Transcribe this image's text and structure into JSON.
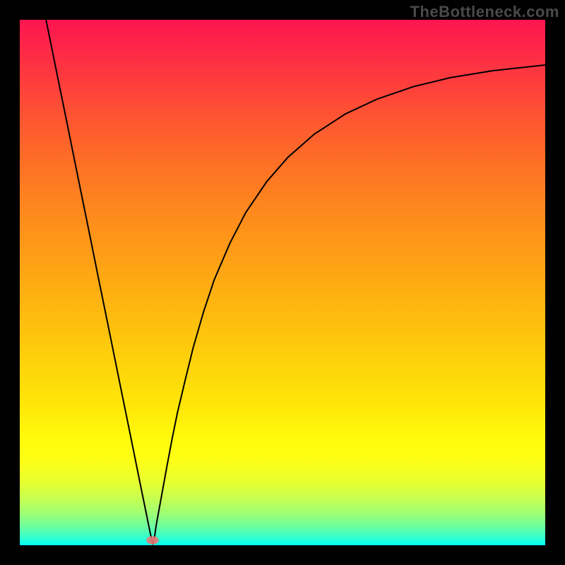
{
  "watermark": "TheBottleneck.com",
  "chart_data": {
    "type": "line",
    "title": "",
    "xlabel": "",
    "ylabel": "",
    "xlim": [
      0,
      100
    ],
    "ylim": [
      0,
      100
    ],
    "grid": false,
    "legend": false,
    "marker": {
      "x": 25.3,
      "y": 0.9
    },
    "series": [
      {
        "name": "bottleneck-curve",
        "color": "#000000",
        "x": [
          5.0,
          7.0,
          9.0,
          11.0,
          13.0,
          15.0,
          17.0,
          19.0,
          21.0,
          23.0,
          24.0,
          25.0,
          25.3,
          25.6,
          26.0,
          27.0,
          28.0,
          29.0,
          30.0,
          31.5,
          33.0,
          35.0,
          37.0,
          40.0,
          43.0,
          47.0,
          51.0,
          56.0,
          62.0,
          68.0,
          75.0,
          82.0,
          90.0,
          100.0
        ],
        "y": [
          100.0,
          90.1,
          80.3,
          70.4,
          60.6,
          50.7,
          40.9,
          31.0,
          21.2,
          11.3,
          6.4,
          1.5,
          0.2,
          1.3,
          4.0,
          9.5,
          15.0,
          20.3,
          25.2,
          31.5,
          37.6,
          44.5,
          50.5,
          57.5,
          63.3,
          69.2,
          73.8,
          78.2,
          82.1,
          84.9,
          87.3,
          89.0,
          90.3,
          91.4
        ]
      }
    ],
    "background_gradient": {
      "type": "vertical-heatmap",
      "stops": [
        {
          "pos": 0.0,
          "color": "#fd1550"
        },
        {
          "pos": 0.08,
          "color": "#fd3043"
        },
        {
          "pos": 0.18,
          "color": "#fe5333"
        },
        {
          "pos": 0.28,
          "color": "#fe7225"
        },
        {
          "pos": 0.4,
          "color": "#fe921a"
        },
        {
          "pos": 0.52,
          "color": "#feb011"
        },
        {
          "pos": 0.64,
          "color": "#fecf0b"
        },
        {
          "pos": 0.74,
          "color": "#ffe808"
        },
        {
          "pos": 0.8,
          "color": "#fffb0b"
        },
        {
          "pos": 0.84,
          "color": "#fdff17"
        },
        {
          "pos": 0.88,
          "color": "#e7ff30"
        },
        {
          "pos": 0.91,
          "color": "#c8ff4f"
        },
        {
          "pos": 0.94,
          "color": "#9dff75"
        },
        {
          "pos": 0.965,
          "color": "#6cffa0"
        },
        {
          "pos": 0.985,
          "color": "#35ffcd"
        },
        {
          "pos": 1.0,
          "color": "#01fff5"
        }
      ]
    }
  }
}
